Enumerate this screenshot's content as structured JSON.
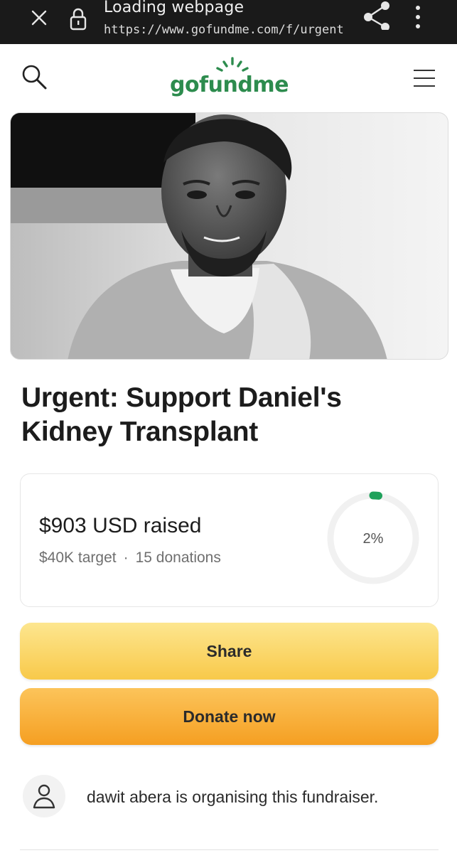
{
  "browser": {
    "status": "Loading webpage",
    "url": "https://www.gofundme.com/f/urgent",
    "icons": [
      "close-icon",
      "lock-icon",
      "share-icon",
      "more-vertical-icon"
    ]
  },
  "header": {
    "logo": "gofundme",
    "icons": [
      "search-icon",
      "menu-icon"
    ],
    "brand_color": "#2d8c4e"
  },
  "campaign": {
    "title": "Urgent: Support Daniel's Kidney Transplant",
    "raised": "$903 USD raised",
    "target": "$40K target",
    "separator": "·",
    "donations": "15 donations",
    "percent_label": "2%",
    "progress_fraction": 0.02,
    "progress_color": "#1fa15b"
  },
  "actions": {
    "share_label": "Share",
    "donate_label": "Donate now",
    "share_color": "#f8c94a",
    "donate_color": "#f59f22"
  },
  "organiser": {
    "text": "dawit abera is organising this fundraiser.",
    "icon": "user-icon"
  }
}
